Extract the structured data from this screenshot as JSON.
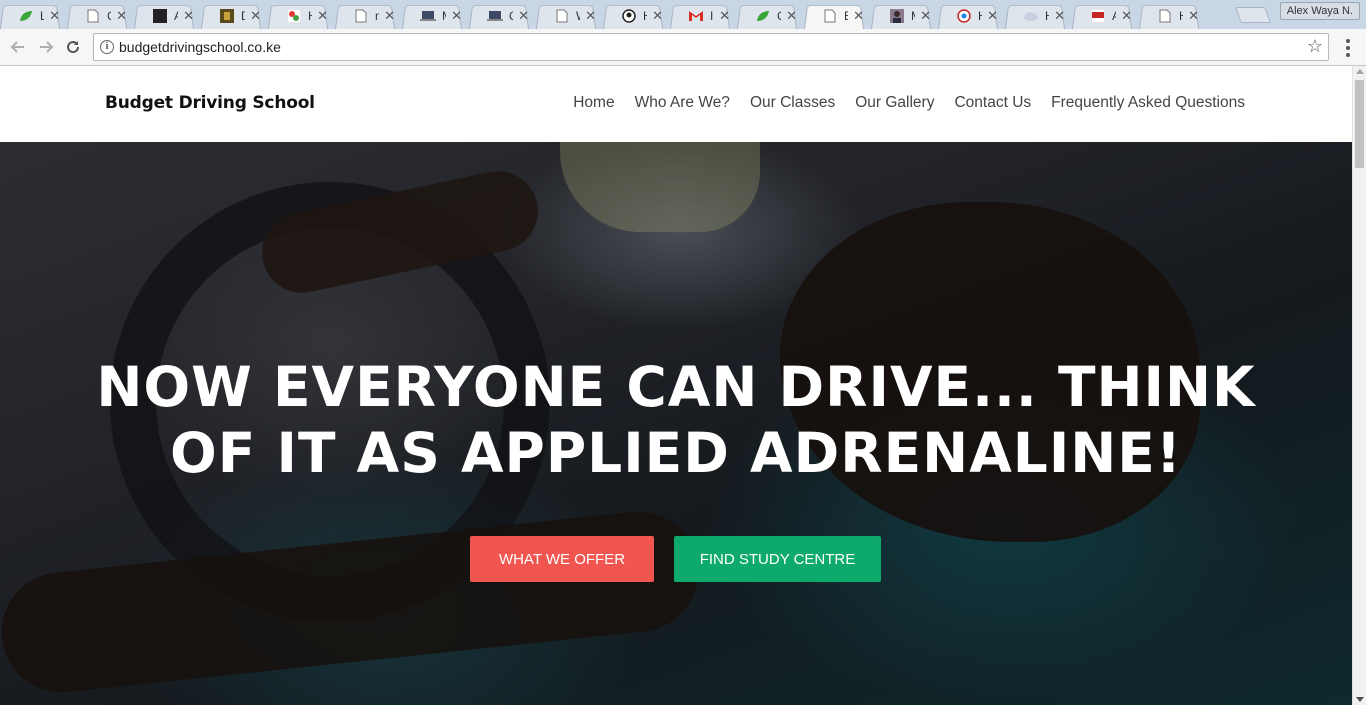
{
  "browser": {
    "tabs": [
      {
        "title": "Li",
        "icon": "leaf-icon",
        "color": "#3aa53a"
      },
      {
        "title": "C",
        "icon": "page-icon"
      },
      {
        "title": "A",
        "icon": "dark-square-icon"
      },
      {
        "title": "D",
        "icon": "photo-icon"
      },
      {
        "title": "H",
        "icon": "colorful-icon"
      },
      {
        "title": "m",
        "icon": "page-icon"
      },
      {
        "title": "M",
        "icon": "laptop-icon"
      },
      {
        "title": "Q",
        "icon": "laptop-icon"
      },
      {
        "title": "W",
        "icon": "page-icon"
      },
      {
        "title": "H",
        "icon": "github-icon"
      },
      {
        "title": "In",
        "icon": "gmail-icon",
        "color": "#d93025"
      },
      {
        "title": "C",
        "icon": "leaf-icon",
        "color": "#3aa53a"
      },
      {
        "title": "B",
        "icon": "page-icon",
        "active": true
      },
      {
        "title": "M",
        "icon": "avatar-icon"
      },
      {
        "title": "H",
        "icon": "badge-icon"
      },
      {
        "title": "H",
        "icon": "cloud-icon"
      },
      {
        "title": "A",
        "icon": "red-logo-icon",
        "color": "#c62828"
      },
      {
        "title": "H",
        "icon": "page-icon"
      }
    ],
    "profile_name": "Alex Waya N.",
    "url": "budgetdrivingschool.co.ke"
  },
  "site": {
    "brand": "Budget Driving School",
    "nav": [
      "Home",
      "Who Are We?",
      "Our Classes",
      "Our Gallery",
      "Contact Us",
      "Frequently Asked Questions"
    ],
    "hero": {
      "line1": "NOW EVERYONE CAN DRIVE... THINK",
      "line2": "OF IT AS APPLIED ADRENALINE!",
      "button_offer": "WHAT WE OFFER",
      "button_study": "FIND STUDY CENTRE"
    }
  },
  "colors": {
    "offer_button": "#f0554f",
    "study_button": "#0daa6b"
  }
}
